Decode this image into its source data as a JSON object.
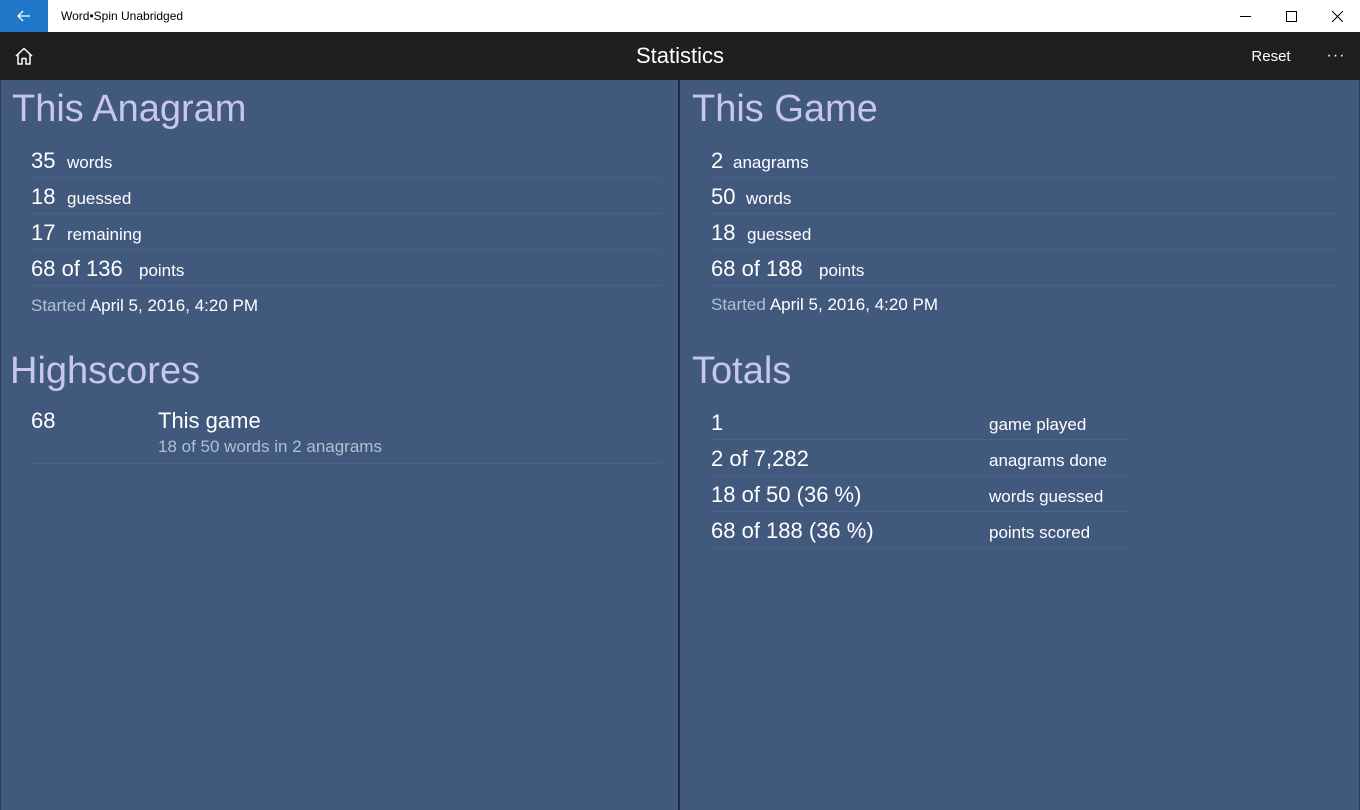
{
  "window": {
    "title": "Word•Spin Unabridged"
  },
  "appbar": {
    "title": "Statistics",
    "reset_label": "Reset",
    "more_label": "···"
  },
  "this_anagram": {
    "heading": "This Anagram",
    "rows": [
      {
        "value": "35",
        "label": "words"
      },
      {
        "value": "18",
        "label": "guessed"
      },
      {
        "value": "17",
        "label": "remaining"
      },
      {
        "value": "68 of 136",
        "label": "points"
      }
    ],
    "started_label": "Started",
    "started_value": "April 5, 2016, 4:20 PM"
  },
  "this_game": {
    "heading": "This Game",
    "rows": [
      {
        "value": "2",
        "label": "anagrams"
      },
      {
        "value": "50",
        "label": "words"
      },
      {
        "value": "18",
        "label": "guessed"
      },
      {
        "value": "68 of 188",
        "label": "points"
      }
    ],
    "started_label": "Started",
    "started_value": "April 5, 2016, 4:20 PM"
  },
  "highscores": {
    "heading": "Highscores",
    "items": [
      {
        "score": "68",
        "title": "This game",
        "subtitle": "18 of 50 words in 2 anagrams"
      }
    ]
  },
  "totals": {
    "heading": "Totals",
    "rows": [
      {
        "value": "1",
        "label": "game played"
      },
      {
        "value": "2 of 7,282",
        "label": "anagrams done"
      },
      {
        "value": "18 of 50 (36 %)",
        "label": "words guessed"
      },
      {
        "value": "68 of 188 (36 %)",
        "label": "points scored"
      }
    ]
  },
  "colors": {
    "background": "#41597d",
    "appbar": "#1f1f1f",
    "accent": "#1f78c8",
    "heading": "#c8c5f0",
    "secondary_text": "#b3bfd3"
  }
}
